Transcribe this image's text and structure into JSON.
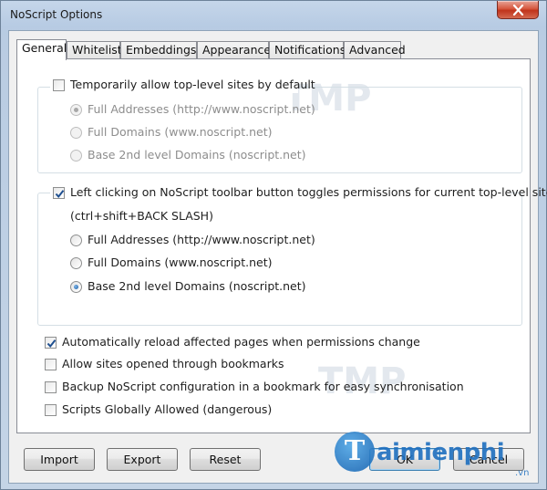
{
  "window": {
    "title": "NoScript Options"
  },
  "tabs": [
    {
      "label": "General",
      "active": true
    },
    {
      "label": "Whitelist",
      "active": false
    },
    {
      "label": "Embeddings",
      "active": false
    },
    {
      "label": "Appearance",
      "active": false
    },
    {
      "label": "Notifications",
      "active": false
    },
    {
      "label": "Advanced",
      "active": false
    }
  ],
  "group1": {
    "checkbox": {
      "label": "Temporarily allow top-level sites by default",
      "checked": false
    },
    "options": [
      {
        "label": "Full Addresses (http://www.noscript.net)",
        "selected": true,
        "enabled": false
      },
      {
        "label": "Full Domains (www.noscript.net)",
        "selected": false,
        "enabled": false
      },
      {
        "label": "Base 2nd level Domains (noscript.net)",
        "selected": false,
        "enabled": false
      }
    ]
  },
  "group2": {
    "checkbox": {
      "label": "Left clicking on NoScript toolbar button toggles permissions for current top-level site",
      "checked": true
    },
    "shortcut": "(ctrl+shift+BACK SLASH)",
    "options": [
      {
        "label": "Full Addresses (http://www.noscript.net)",
        "selected": false,
        "enabled": true
      },
      {
        "label": "Full Domains (www.noscript.net)",
        "selected": false,
        "enabled": true
      },
      {
        "label": "Base 2nd level Domains (noscript.net)",
        "selected": true,
        "enabled": true
      }
    ]
  },
  "options": [
    {
      "label": "Automatically reload affected pages when permissions change",
      "checked": true
    },
    {
      "label": "Allow sites opened through bookmarks",
      "checked": false
    },
    {
      "label": "Backup NoScript configuration in a bookmark for easy synchronisation",
      "checked": false
    },
    {
      "label": "Scripts Globally Allowed (dangerous)",
      "checked": false
    }
  ],
  "buttons": {
    "import": "Import",
    "export": "Export",
    "reset": "Reset",
    "ok": "OK",
    "cancel": "Cancel"
  },
  "watermark": {
    "logo": "T",
    "text": "aimienphi",
    "sub": ".vn",
    "faint": "TMP"
  },
  "colors": {
    "accent": "#1d5fa8",
    "close": "#c0331b",
    "watermark": "#1e6fbf"
  }
}
